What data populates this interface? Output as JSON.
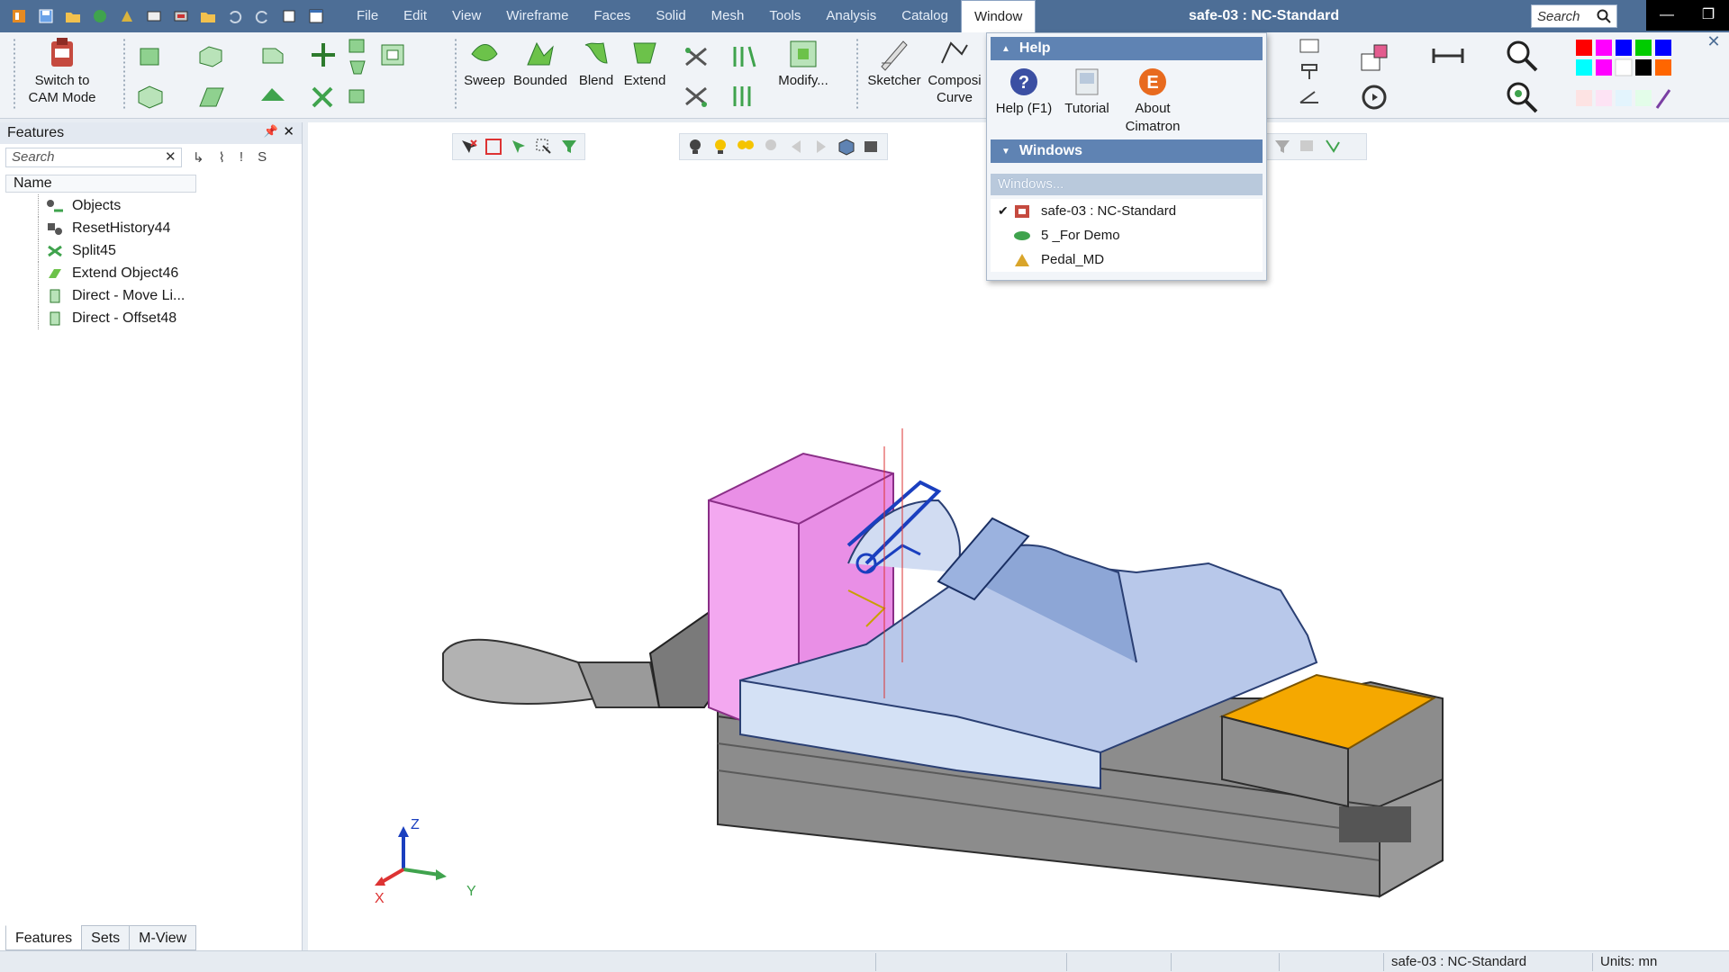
{
  "menubar": {
    "items": [
      "File",
      "Edit",
      "View",
      "Wireframe",
      "Faces",
      "Solid",
      "Mesh",
      "Tools",
      "Analysis",
      "Catalog",
      "Window"
    ],
    "active": "Window",
    "title": "safe-03 : NC-Standard",
    "search_placeholder": "Search"
  },
  "ribbon": {
    "switch_cam": "Switch to CAM Mode",
    "sweep": "Sweep",
    "bounded": "Bounded",
    "blend": "Blend",
    "extend": "Extend",
    "modify": "Modify...",
    "sketcher": "Sketcher",
    "composite": "Composi",
    "composite2": "Curve"
  },
  "window_menu": {
    "help_section": "Help",
    "help_f1": "Help (F1)",
    "tutorial": "Tutorial",
    "about": "About Cimatron",
    "windows_section": "Windows",
    "windows_sub": "Windows...",
    "windows": [
      {
        "label": "safe-03 : NC-Standard",
        "checked": true
      },
      {
        "label": "5 _For Demo",
        "checked": false
      },
      {
        "label": "Pedal_MD",
        "checked": false
      }
    ]
  },
  "features_panel": {
    "title": "Features",
    "search_placeholder": "Search",
    "column": "Name",
    "items": [
      "Objects",
      "ResetHistory44",
      "Split45",
      "Extend Object46",
      "Direct - Move Li...",
      "Direct - Offset48"
    ],
    "tabs": [
      "Features",
      "Sets",
      "M-View"
    ],
    "active_tab": "Features"
  },
  "axes": {
    "z": "Z",
    "x": "X",
    "y": "Y"
  },
  "statusbar": {
    "document": "safe-03 : NC-Standard",
    "units": "Units: mn"
  },
  "colors": {
    "titlebar": "#4d6e96",
    "pink_block": "#e98fe6",
    "orange_block": "#f5a800",
    "blue_part": "#b8c8ea"
  }
}
